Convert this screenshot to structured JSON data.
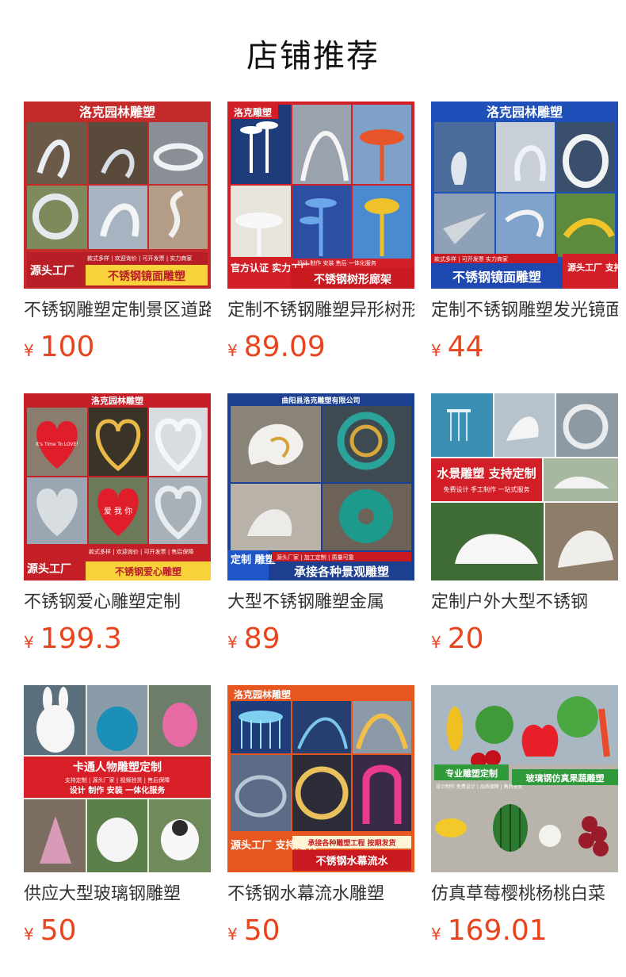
{
  "page": {
    "title": "店铺推荐"
  },
  "currency_symbol": "¥",
  "products": [
    {
      "name": "不锈钢雕塑定制景区道路广场",
      "price": "100",
      "image": {
        "banner": "洛克园林雕塑",
        "badge": "源头工厂",
        "strip": "款式多样 | 欢迎询价 | 可开发票 | 实力商家",
        "caption": "不锈钢镜面雕塑"
      }
    },
    {
      "name": "定制不锈钢雕塑异形树形廊架",
      "price": "89.09",
      "image": {
        "banner": "洛克雕塑",
        "badge": "官方认证 实力工厂",
        "strip": "设计 制作 安装 售后 一体化服务",
        "caption": "不锈钢树形廊架"
      }
    },
    {
      "name": "定制不锈钢雕塑发光镜面",
      "price": "44",
      "image": {
        "banner": "洛克园林雕塑",
        "badge": "源头工厂 支持定制",
        "strip": "款式多样 | 可开发票 实力商家",
        "caption": "不锈钢镜面雕塑"
      }
    },
    {
      "name": "不锈钢爱心雕塑定制",
      "price": "199.3",
      "image": {
        "banner": "洛克园林雕塑",
        "badge": "源头工厂",
        "strip": "款式多样 | 欢迎询价 | 可开发票 | 售后保障",
        "caption": "不锈钢爱心雕塑",
        "heart_text_1": "It's Time To LOVE!",
        "heart_text_2": "爱 我 你"
      }
    },
    {
      "name": "大型不锈钢雕塑金属",
      "price": "89",
      "image": {
        "banner": "曲阳县洛克雕塑有限公司",
        "badge": "定制 雕塑",
        "strip": "源头厂家 | 加工定制 | 质量可靠",
        "caption": "承接各种景观雕塑"
      }
    },
    {
      "name": "定制户外大型不锈钢",
      "price": "20",
      "image": {
        "banner": "",
        "badge": "",
        "strip": "免费设计 手工制作 一站式服务",
        "caption": "水景雕塑 支持定制"
      }
    },
    {
      "name": "供应大型玻璃钢雕塑",
      "price": "50",
      "image": {
        "banner": "",
        "badge": "",
        "strip": "支持定制 | 源头厂家 | 视频验货 | 售后保障",
        "caption": "卡通人物雕塑定制",
        "sub": "设计 制作 安装 一体化服务"
      }
    },
    {
      "name": "不锈钢水幕流水雕塑",
      "price": "50",
      "image": {
        "banner": "洛克园林雕塑",
        "badge": "源头工厂 支持定制",
        "strip": "承接各种雕塑工程 按期发货",
        "caption": "不锈钢水幕流水"
      }
    },
    {
      "name": "仿真草莓樱桃杨桃白菜",
      "price": "169.01",
      "image": {
        "banner": "",
        "badge": "专业雕塑定制",
        "strip": "设计制作 免费设计 | 品质保障 | 售后无忧",
        "caption": "玻璃钢仿真果蔬雕塑"
      }
    }
  ],
  "colors": {
    "price": "#e8441d",
    "banner_red": "#d9232b",
    "banner_blue": "#2a5bd7"
  }
}
